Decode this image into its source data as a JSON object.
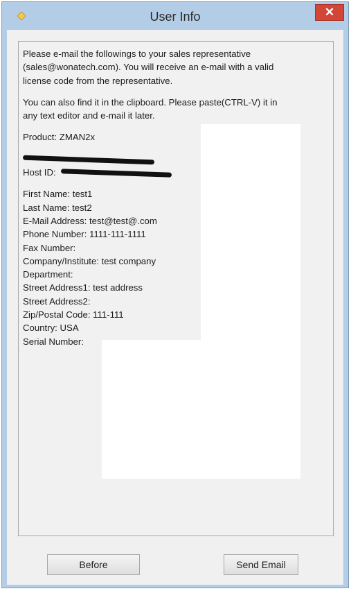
{
  "window": {
    "title": "User Info",
    "close_glyph": "✕"
  },
  "content": {
    "para1": [
      "Please e-mail the followings to your sales representative",
      "(sales@wonatech.com). You will receive an e-mail with a valid",
      "license code from the representative."
    ],
    "para2": [
      "You can also find it in the clipboard. Please paste(CTRL-V) it in",
      "any text editor and e-mail it later."
    ],
    "product": "Product:  ZMAN2x",
    "host_id_label": "Host ID:",
    "fields": [
      "First Name: test1",
      "Last Name: test2",
      "E-Mail Address: test@test@.com",
      "Phone Number: 1111-111-1111",
      "Fax Number:",
      "Company/Institute: test company",
      "Department:",
      "Street Address1: test address",
      "Street Address2:",
      "Zip/Postal Code: 111-111",
      "Country: USA",
      "Serial Number:"
    ]
  },
  "buttons": {
    "before": "Before",
    "send_email": "Send Email"
  },
  "colors": {
    "close": "#d14637",
    "frame": "#b3cde6"
  }
}
